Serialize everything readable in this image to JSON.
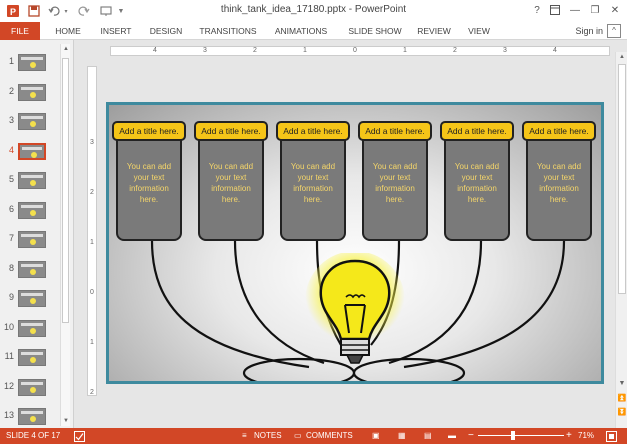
{
  "window": {
    "title": "think_tank_idea_17180.pptx - PowerPoint",
    "help": "?",
    "min": "—",
    "restore": "❐",
    "close": "✕"
  },
  "qat": {
    "app_icon": "powerpoint-icon",
    "save_icon": "save-icon",
    "undo_icon": "undo-icon",
    "redo_icon": "redo-icon",
    "start_icon": "start-from-beginning-icon",
    "customize": "▼"
  },
  "tabs": [
    {
      "label": "FILE"
    },
    {
      "label": "HOME"
    },
    {
      "label": "INSERT"
    },
    {
      "label": "DESIGN"
    },
    {
      "label": "TRANSITIONS"
    },
    {
      "label": "ANIMATIONS"
    },
    {
      "label": "SLIDE SHOW"
    },
    {
      "label": "REVIEW"
    },
    {
      "label": "VIEW"
    }
  ],
  "signin": "Sign in",
  "ribbon_collapse": "^",
  "slides": {
    "numbers": [
      "1",
      "2",
      "3",
      "4",
      "5",
      "6",
      "7",
      "8",
      "9",
      "10",
      "11",
      "12",
      "13"
    ],
    "active": "4"
  },
  "ruler": {
    "h": [
      "4",
      "3",
      "2",
      "1",
      "0",
      "1",
      "2",
      "3",
      "4"
    ],
    "v": [
      "3",
      "2",
      "1",
      "0",
      "1",
      "2",
      "3"
    ]
  },
  "slide": {
    "cards": [
      {
        "title": "Add a title here.",
        "text": "You can add your text information here."
      },
      {
        "title": "Add a title here.",
        "text": "You can add your text information here."
      },
      {
        "title": "Add a title here.",
        "text": "You can add your text information here."
      },
      {
        "title": "Add a title here.",
        "text": "You can add your text information here."
      },
      {
        "title": "Add a title here.",
        "text": "You can add your text information here."
      },
      {
        "title": "Add a title here.",
        "text": "You can add your text information here."
      }
    ],
    "colors": {
      "title_fill": "#f5c518",
      "card_fill": "#7a7a7a",
      "text": "#f5d66a",
      "frame": "#3e8a9e"
    }
  },
  "status": {
    "slide_info": "SLIDE 4 OF 17",
    "notes": "NOTES",
    "comments": "COMMENTS",
    "zoom_minus": "−",
    "zoom_plus": "+",
    "zoom": "71%",
    "zoom_fraction": 0.38
  }
}
